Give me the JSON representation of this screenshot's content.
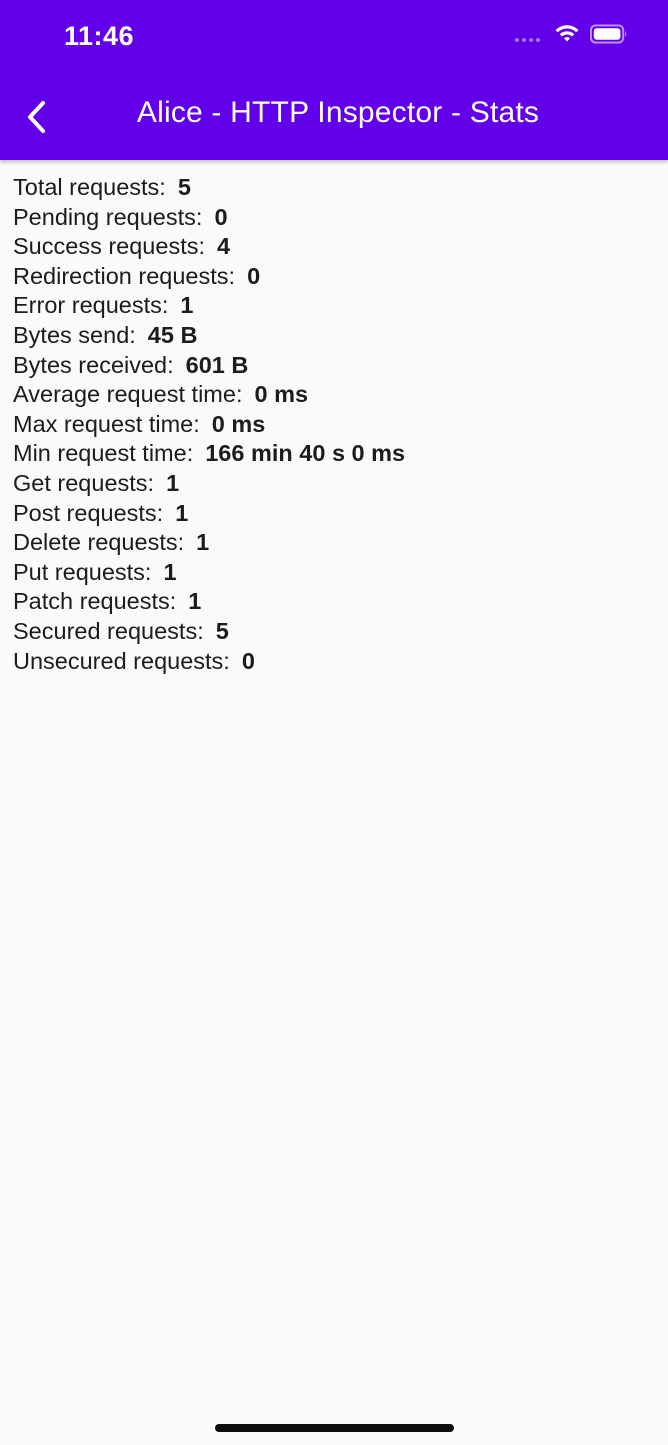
{
  "status_bar": {
    "time": "11:46"
  },
  "app_bar": {
    "title": "Alice - HTTP Inspector - Stats",
    "back_icon": "chevron-left-icon",
    "background_color": "#6200ea"
  },
  "stats": [
    {
      "label": "Total requests:",
      "value": "5"
    },
    {
      "label": "Pending requests:",
      "value": "0"
    },
    {
      "label": "Success requests:",
      "value": "4"
    },
    {
      "label": "Redirection requests:",
      "value": "0"
    },
    {
      "label": "Error requests:",
      "value": "1"
    },
    {
      "label": "Bytes send:",
      "value": "45 B"
    },
    {
      "label": "Bytes received:",
      "value": "601 B"
    },
    {
      "label": "Average request time:",
      "value": "0 ms"
    },
    {
      "label": "Max request time:",
      "value": "0 ms"
    },
    {
      "label": "Min request time:",
      "value": "166 min 40 s 0 ms"
    },
    {
      "label": "Get requests:",
      "value": "1"
    },
    {
      "label": "Post requests:",
      "value": "1"
    },
    {
      "label": "Delete requests:",
      "value": "1"
    },
    {
      "label": "Put requests:",
      "value": "1"
    },
    {
      "label": "Patch requests:",
      "value": "1"
    },
    {
      "label": "Secured requests:",
      "value": "5"
    },
    {
      "label": "Unsecured requests:",
      "value": "0"
    }
  ]
}
